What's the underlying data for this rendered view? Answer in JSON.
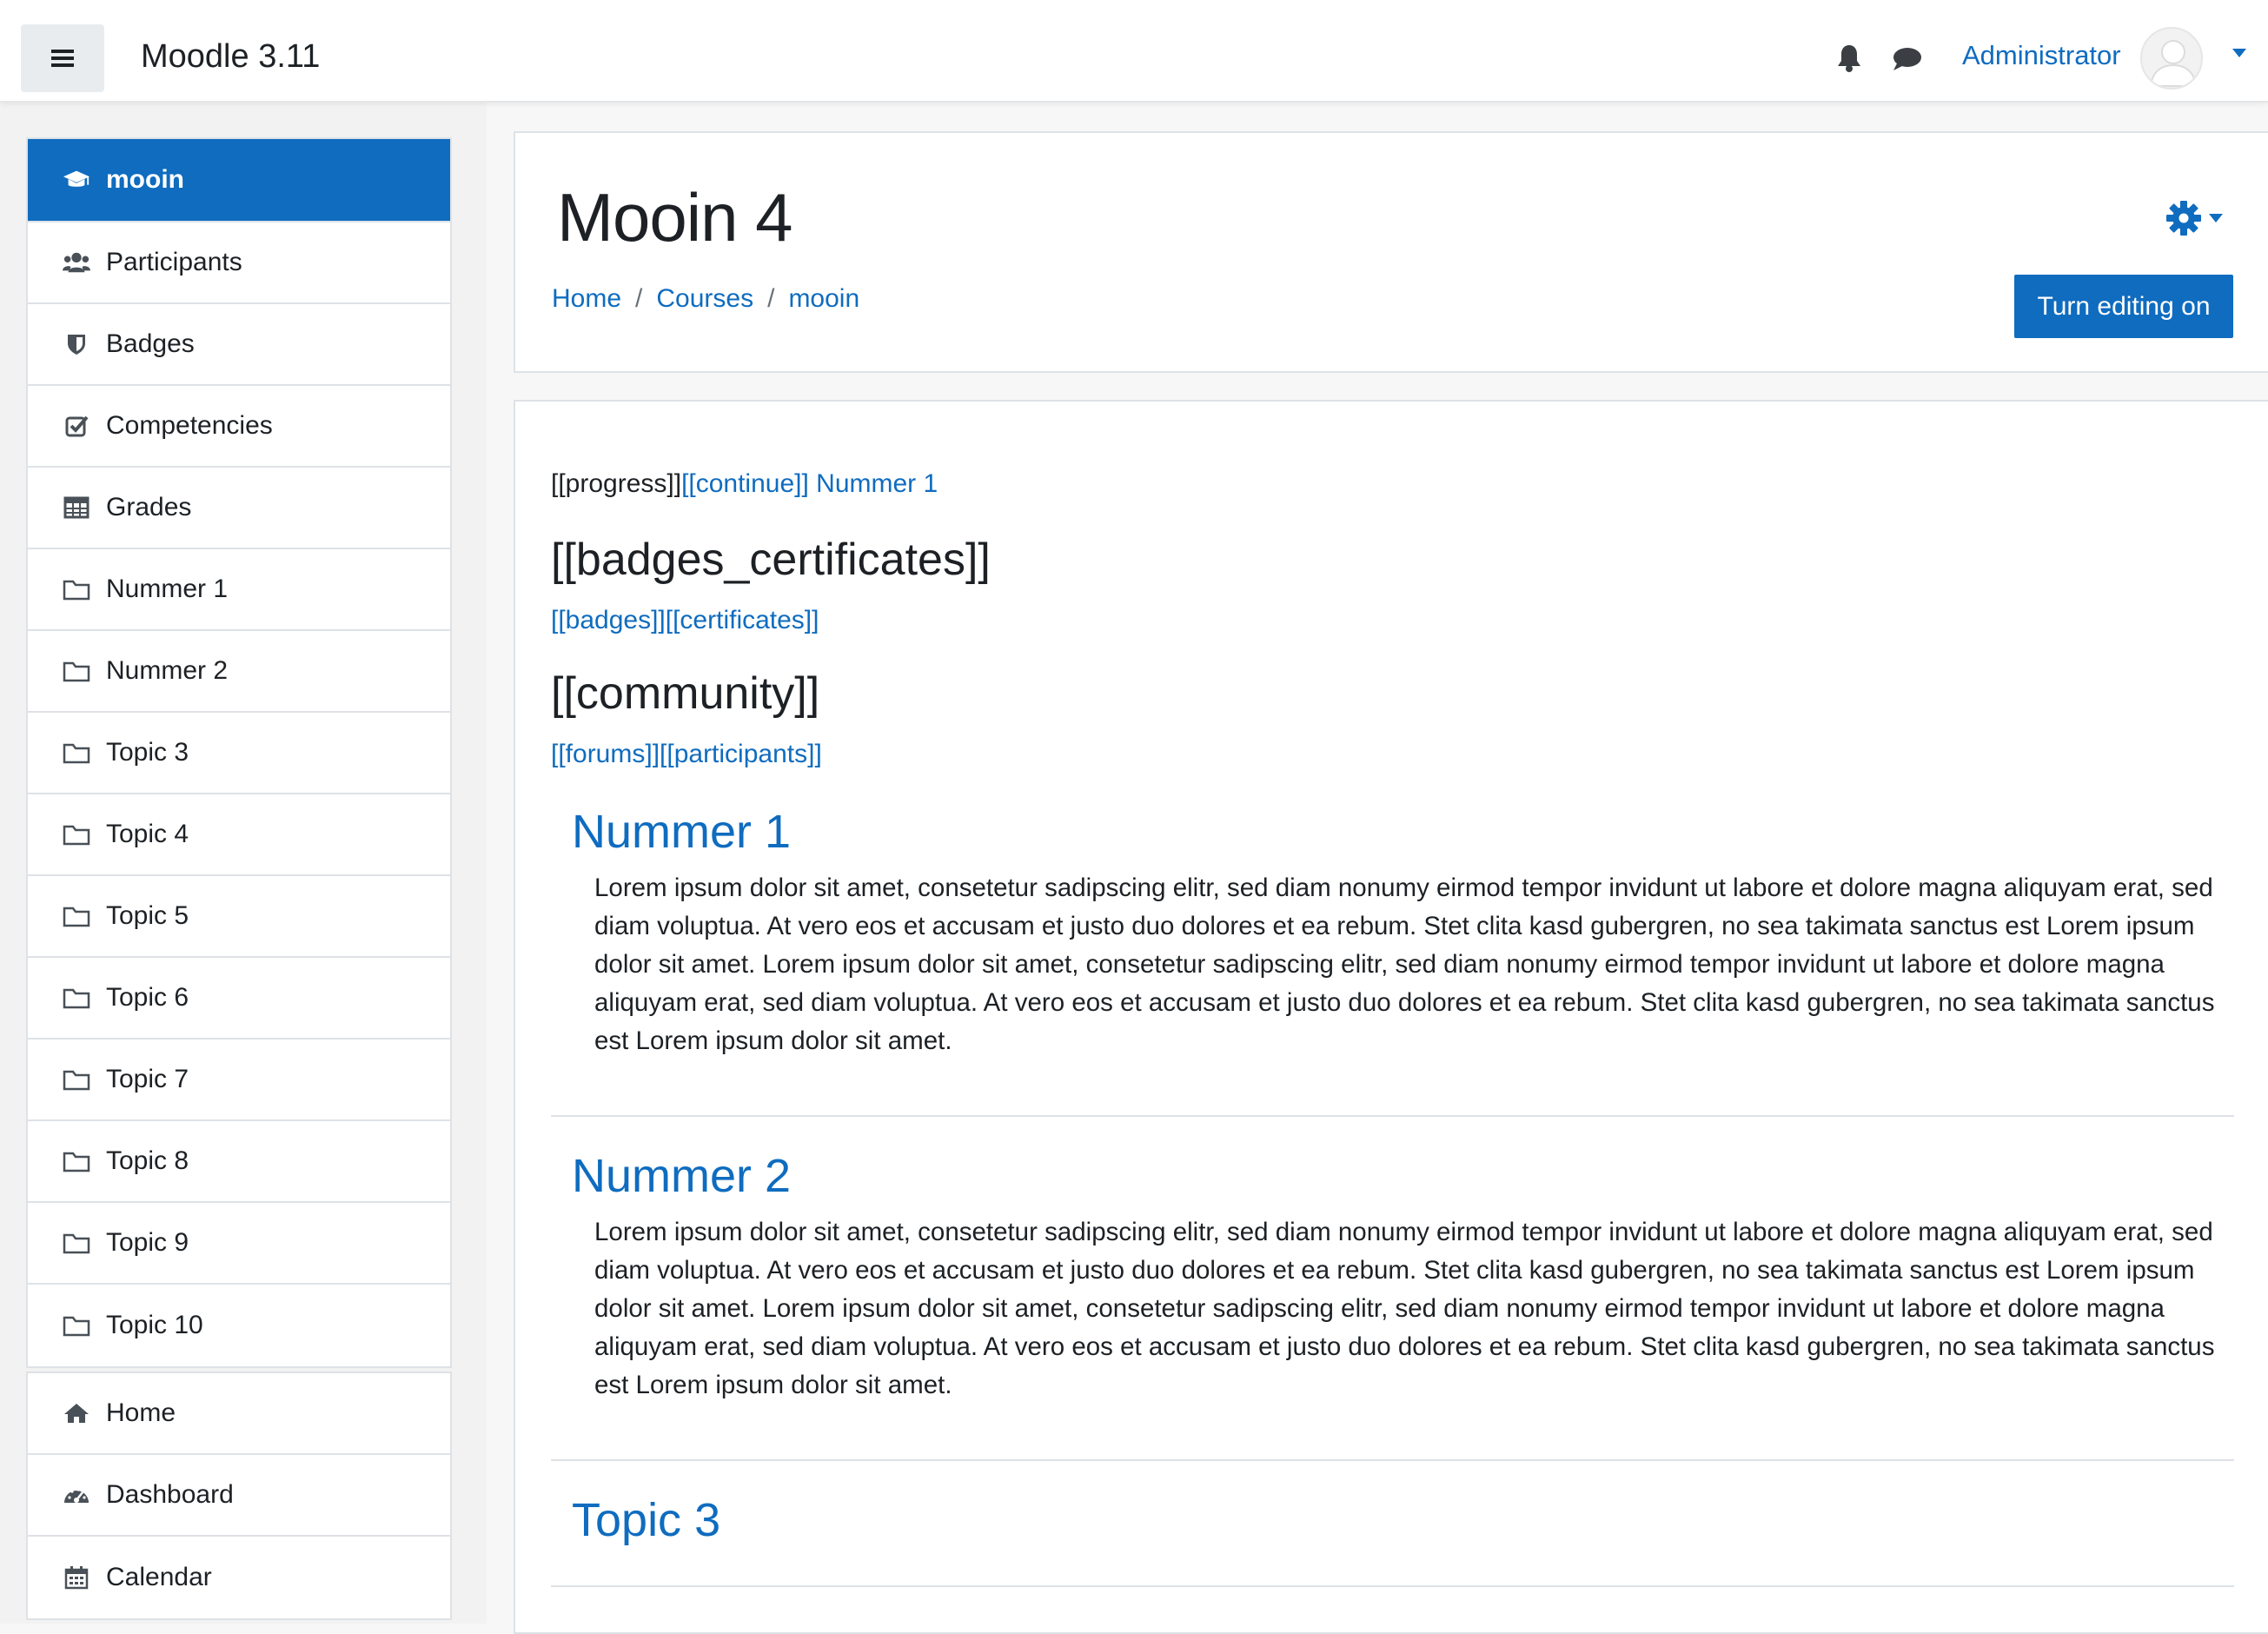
{
  "navbar": {
    "brand": "Moodle 3.11",
    "user_name": "Administrator",
    "icons": [
      "menu-icon",
      "bell-icon",
      "chat-icon",
      "caret-down-icon"
    ]
  },
  "drawer": {
    "main_items": [
      {
        "label": "mooin",
        "icon": "graduation-cap-icon",
        "active": true
      },
      {
        "label": "Participants",
        "icon": "users-icon"
      },
      {
        "label": "Badges",
        "icon": "shield-icon"
      },
      {
        "label": "Competencies",
        "icon": "check-square-icon"
      },
      {
        "label": "Grades",
        "icon": "table-icon"
      },
      {
        "label": "Nummer 1",
        "icon": "folder-icon"
      },
      {
        "label": "Nummer 2",
        "icon": "folder-icon"
      },
      {
        "label": "Topic 3",
        "icon": "folder-icon"
      },
      {
        "label": "Topic 4",
        "icon": "folder-icon"
      },
      {
        "label": "Topic 5",
        "icon": "folder-icon"
      },
      {
        "label": "Topic 6",
        "icon": "folder-icon"
      },
      {
        "label": "Topic 7",
        "icon": "folder-icon"
      },
      {
        "label": "Topic 8",
        "icon": "folder-icon"
      },
      {
        "label": "Topic 9",
        "icon": "folder-icon"
      },
      {
        "label": "Topic 10",
        "icon": "folder-icon"
      }
    ],
    "site_items": [
      {
        "label": "Home",
        "icon": "home-icon"
      },
      {
        "label": "Dashboard",
        "icon": "dashboard-icon"
      },
      {
        "label": "Calendar",
        "icon": "calendar-icon"
      }
    ]
  },
  "header": {
    "course_title": "Mooin 4",
    "breadcrumb": [
      "Home",
      "Courses",
      "mooin"
    ],
    "breadcrumb_separator": "/",
    "edit_button": "Turn editing on"
  },
  "content": {
    "progress_text": "[[progress]]",
    "continue_link": "[[continue]] Nummer 1",
    "badges_heading": "[[badges_certificates]]",
    "badges_links": "[[badges]][[certificates]]",
    "community_heading": "[[community]]",
    "community_links": "[[forums]][[participants]]",
    "sections": [
      {
        "title": "Nummer 1",
        "summary": "Lorem ipsum dolor sit amet, consetetur sadipscing elitr, sed diam nonumy eirmod tempor invidunt ut labore et dolore magna aliquyam erat, sed diam voluptua. At vero eos et accusam et justo duo dolores et ea rebum. Stet clita kasd gubergren, no sea takimata sanctus est Lorem ipsum dolor sit amet. Lorem ipsum dolor sit amet, consetetur sadipscing elitr, sed diam nonumy eirmod tempor invidunt ut labore et dolore magna aliquyam erat, sed diam voluptua. At vero eos et accusam et justo duo dolores et ea rebum. Stet clita kasd gubergren, no sea takimata sanctus est Lorem ipsum dolor sit amet."
      },
      {
        "title": "Nummer 2",
        "summary": "Lorem ipsum dolor sit amet, consetetur sadipscing elitr, sed diam nonumy eirmod tempor invidunt ut labore et dolore magna aliquyam erat, sed diam voluptua. At vero eos et accusam et justo duo dolores et ea rebum. Stet clita kasd gubergren, no sea takimata sanctus est Lorem ipsum dolor sit amet. Lorem ipsum dolor sit amet, consetetur sadipscing elitr, sed diam nonumy eirmod tempor invidunt ut labore et dolore magna aliquyam erat, sed diam voluptua. At vero eos et accusam et justo duo dolores et ea rebum. Stet clita kasd gubergren, no sea takimata sanctus est Lorem ipsum dolor sit amet."
      },
      {
        "title": "Topic 3",
        "summary": ""
      }
    ]
  },
  "colors": {
    "accent": "#0f6cbf",
    "text": "#1d2125",
    "drawer_bg": "#f2f2f2",
    "border": "#dee2e6"
  }
}
